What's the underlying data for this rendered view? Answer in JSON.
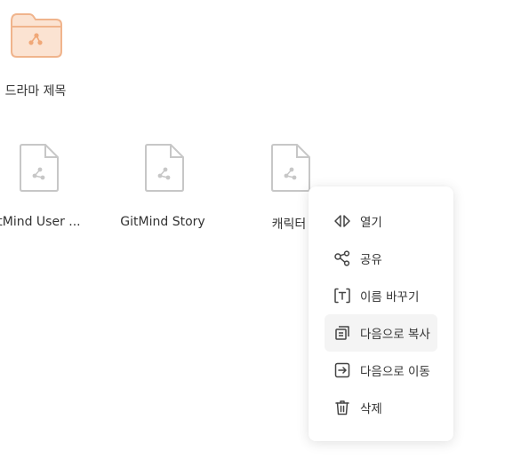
{
  "colors": {
    "folder_accent": "#f5c5a4",
    "file_gray": "#c7c7c7",
    "menu_hover_bg": "#f4f4f4",
    "text": "#333333"
  },
  "items": [
    {
      "label": "드라마 제목",
      "type": "folder",
      "icon": "mindmap-folder-icon"
    },
    {
      "label": "itMind User ...",
      "type": "file",
      "icon": "mindmap-file-icon"
    },
    {
      "label": "GitMind Story",
      "type": "file",
      "icon": "mindmap-file-icon"
    },
    {
      "label": "캐릭터",
      "type": "file",
      "icon": "mindmap-file-icon"
    }
  ],
  "context_menu": {
    "items": [
      {
        "label": "열기",
        "icon": "open-icon"
      },
      {
        "label": "공유",
        "icon": "share-icon"
      },
      {
        "label": "이름 바꾸기",
        "icon": "rename-icon"
      },
      {
        "label": "다음으로 복사",
        "icon": "copy-icon",
        "hovered": true
      },
      {
        "label": "다음으로 이동",
        "icon": "move-icon"
      },
      {
        "label": "삭제",
        "icon": "trash-icon"
      }
    ]
  }
}
